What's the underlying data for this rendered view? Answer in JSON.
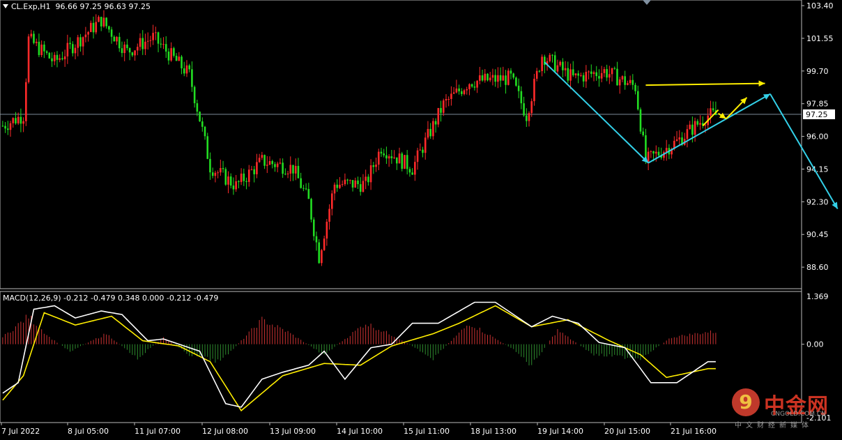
{
  "header": {
    "symbol": "CL.Exp,H1",
    "ohlc": "96.66 97.25 96.63 97.25",
    "macd_label": "MACD(12,26,9) -0.212 -0.479 0.348 0.000 -0.212 -0.479"
  },
  "price_axis": {
    "ticks": [
      "103.40",
      "101.55",
      "99.70",
      "97.85",
      "96.00",
      "94.15",
      "92.30",
      "90.45",
      "88.60"
    ],
    "current": "97.25"
  },
  "macd_axis": {
    "ticks": [
      "1.369",
      "0.00",
      "-2.101"
    ]
  },
  "time_axis": [
    "7 Jul 2022",
    "8 Jul 05:00",
    "11 Jul 07:00",
    "12 Jul 08:00",
    "13 Jul 09:00",
    "14 Jul 10:00",
    "15 Jul 11:00",
    "18 Jul 13:00",
    "19 Jul 14:00",
    "20 Jul 15:00",
    "21 Jul 16:00"
  ],
  "watermark": {
    "glyph": "9",
    "name": "中金网",
    "site": "CNGOLD.COM.CN",
    "sub": "中文财经新媒体"
  },
  "colors": {
    "up": "#ff2a2a",
    "down": "#22dd22",
    "grid": "#2a2a2a",
    "price_line": "#8fa0b0",
    "cyan": "#33d0e8",
    "yellow": "#ffee00",
    "macd_line": "#ffffff",
    "signal_line": "#ffee00",
    "hist_up": "#cc3333",
    "hist_down": "#2e8b2e"
  },
  "chart_data": [
    {
      "type": "candlestick",
      "x_start": "7 Jul 2022",
      "interval": "H1",
      "ylim": [
        87.5,
        103.6
      ],
      "current_price": 97.25,
      "close_path": [
        {
          "bar": 0,
          "price": 96.6
        },
        {
          "bar": 8,
          "price": 97.2
        },
        {
          "bar": 10,
          "price": 101.5
        },
        {
          "bar": 20,
          "price": 100.2
        },
        {
          "bar": 38,
          "price": 102.6
        },
        {
          "bar": 48,
          "price": 100.8
        },
        {
          "bar": 58,
          "price": 101.6
        },
        {
          "bar": 72,
          "price": 99.5
        },
        {
          "bar": 76,
          "price": 97.0
        },
        {
          "bar": 80,
          "price": 94.3
        },
        {
          "bar": 90,
          "price": 93.2
        },
        {
          "bar": 100,
          "price": 94.6
        },
        {
          "bar": 112,
          "price": 94.2
        },
        {
          "bar": 118,
          "price": 92.3
        },
        {
          "bar": 122,
          "price": 89.2
        },
        {
          "bar": 128,
          "price": 93.3
        },
        {
          "bar": 140,
          "price": 93.3
        },
        {
          "bar": 146,
          "price": 95.4
        },
        {
          "bar": 158,
          "price": 94.2
        },
        {
          "bar": 170,
          "price": 97.8
        },
        {
          "bar": 180,
          "price": 99.1
        },
        {
          "bar": 196,
          "price": 99.3
        },
        {
          "bar": 202,
          "price": 97.2
        },
        {
          "bar": 208,
          "price": 100.6
        },
        {
          "bar": 220,
          "price": 99.3
        },
        {
          "bar": 232,
          "price": 99.7
        },
        {
          "bar": 244,
          "price": 98.8
        },
        {
          "bar": 248,
          "price": 94.6
        },
        {
          "bar": 260,
          "price": 95.7
        },
        {
          "bar": 272,
          "price": 97.2
        }
      ],
      "annotations": {
        "cyan_lines": [
          {
            "from": {
              "bar": 209,
              "price": 100.2
            },
            "to": {
              "bar": 249,
              "price": 94.5
            }
          },
          {
            "from": {
              "bar": 249,
              "price": 94.5
            },
            "to": {
              "bar": 296,
              "price": 98.4
            }
          },
          {
            "from": {
              "bar": 296,
              "price": 98.4
            },
            "to": {
              "bar": 322,
              "price": 91.9
            }
          }
        ],
        "yellow_lines": [
          {
            "from": {
              "bar": 248,
              "price": 98.9
            },
            "to": {
              "bar": 294,
              "price": 99.0
            }
          },
          {
            "from": {
              "bar": 270,
              "price": 96.6
            },
            "to": {
              "bar": 276,
              "price": 97.5
            }
          },
          {
            "from": {
              "bar": 276,
              "price": 97.3
            },
            "to": {
              "bar": 279,
              "price": 97.0
            }
          },
          {
            "from": {
              "bar": 279,
              "price": 97.0
            },
            "to": {
              "bar": 287,
              "price": 98.2
            }
          }
        ]
      }
    },
    {
      "type": "line",
      "title": "MACD(12,26,9)",
      "ylim": [
        -2.101,
        1.369
      ],
      "macd_path": [
        {
          "bar": 0,
          "value": -1.4
        },
        {
          "bar": 6,
          "value": -1.1
        },
        {
          "bar": 12,
          "value": 1.0
        },
        {
          "bar": 20,
          "value": 1.1
        },
        {
          "bar": 28,
          "value": 0.75
        },
        {
          "bar": 38,
          "value": 0.95
        },
        {
          "bar": 46,
          "value": 0.85
        },
        {
          "bar": 56,
          "value": 0.1
        },
        {
          "bar": 62,
          "value": 0.15
        },
        {
          "bar": 76,
          "value": -0.2
        },
        {
          "bar": 86,
          "value": -1.7
        },
        {
          "bar": 92,
          "value": -1.8
        },
        {
          "bar": 100,
          "value": -1.0
        },
        {
          "bar": 108,
          "value": -0.8
        },
        {
          "bar": 118,
          "value": -0.6
        },
        {
          "bar": 124,
          "value": -0.2
        },
        {
          "bar": 132,
          "value": -1.0
        },
        {
          "bar": 142,
          "value": -0.1
        },
        {
          "bar": 150,
          "value": 0.0
        },
        {
          "bar": 158,
          "value": 0.6
        },
        {
          "bar": 168,
          "value": 0.6
        },
        {
          "bar": 182,
          "value": 1.2
        },
        {
          "bar": 190,
          "value": 1.2
        },
        {
          "bar": 204,
          "value": 0.5
        },
        {
          "bar": 212,
          "value": 0.8
        },
        {
          "bar": 222,
          "value": 0.6
        },
        {
          "bar": 230,
          "value": 0.05
        },
        {
          "bar": 240,
          "value": -0.1
        },
        {
          "bar": 250,
          "value": -1.1
        },
        {
          "bar": 260,
          "value": -1.1
        },
        {
          "bar": 272,
          "value": -0.5
        }
      ],
      "signal_path": [
        {
          "bar": 0,
          "value": -1.6
        },
        {
          "bar": 8,
          "value": -0.9
        },
        {
          "bar": 16,
          "value": 0.9
        },
        {
          "bar": 28,
          "value": 0.55
        },
        {
          "bar": 42,
          "value": 0.8
        },
        {
          "bar": 54,
          "value": 0.1
        },
        {
          "bar": 68,
          "value": -0.05
        },
        {
          "bar": 80,
          "value": -0.5
        },
        {
          "bar": 92,
          "value": -1.9
        },
        {
          "bar": 108,
          "value": -0.9
        },
        {
          "bar": 124,
          "value": -0.55
        },
        {
          "bar": 138,
          "value": -0.6
        },
        {
          "bar": 150,
          "value": -0.05
        },
        {
          "bar": 166,
          "value": 0.3
        },
        {
          "bar": 176,
          "value": 0.6
        },
        {
          "bar": 190,
          "value": 1.1
        },
        {
          "bar": 204,
          "value": 0.5
        },
        {
          "bar": 218,
          "value": 0.7
        },
        {
          "bar": 234,
          "value": 0.1
        },
        {
          "bar": 246,
          "value": -0.3
        },
        {
          "bar": 256,
          "value": -0.95
        },
        {
          "bar": 272,
          "value": -0.7
        }
      ],
      "histogram_path": [
        {
          "bar": 0,
          "value": 0.2
        },
        {
          "bar": 10,
          "value": 0.8
        },
        {
          "bar": 18,
          "value": 0.2
        },
        {
          "bar": 26,
          "value": -0.2
        },
        {
          "bar": 40,
          "value": 0.3
        },
        {
          "bar": 52,
          "value": -0.4
        },
        {
          "bar": 62,
          "value": 0.2
        },
        {
          "bar": 72,
          "value": -0.3
        },
        {
          "bar": 84,
          "value": -0.5
        },
        {
          "bar": 100,
          "value": 0.7
        },
        {
          "bar": 110,
          "value": 0.35
        },
        {
          "bar": 124,
          "value": -0.3
        },
        {
          "bar": 140,
          "value": 0.6
        },
        {
          "bar": 152,
          "value": 0.2
        },
        {
          "bar": 166,
          "value": -0.4
        },
        {
          "bar": 180,
          "value": 0.6
        },
        {
          "bar": 196,
          "value": -0.1
        },
        {
          "bar": 204,
          "value": -0.6
        },
        {
          "bar": 214,
          "value": 0.4
        },
        {
          "bar": 228,
          "value": -0.3
        },
        {
          "bar": 246,
          "value": -0.4
        },
        {
          "bar": 258,
          "value": 0.2
        },
        {
          "bar": 272,
          "value": 0.35
        }
      ]
    }
  ]
}
